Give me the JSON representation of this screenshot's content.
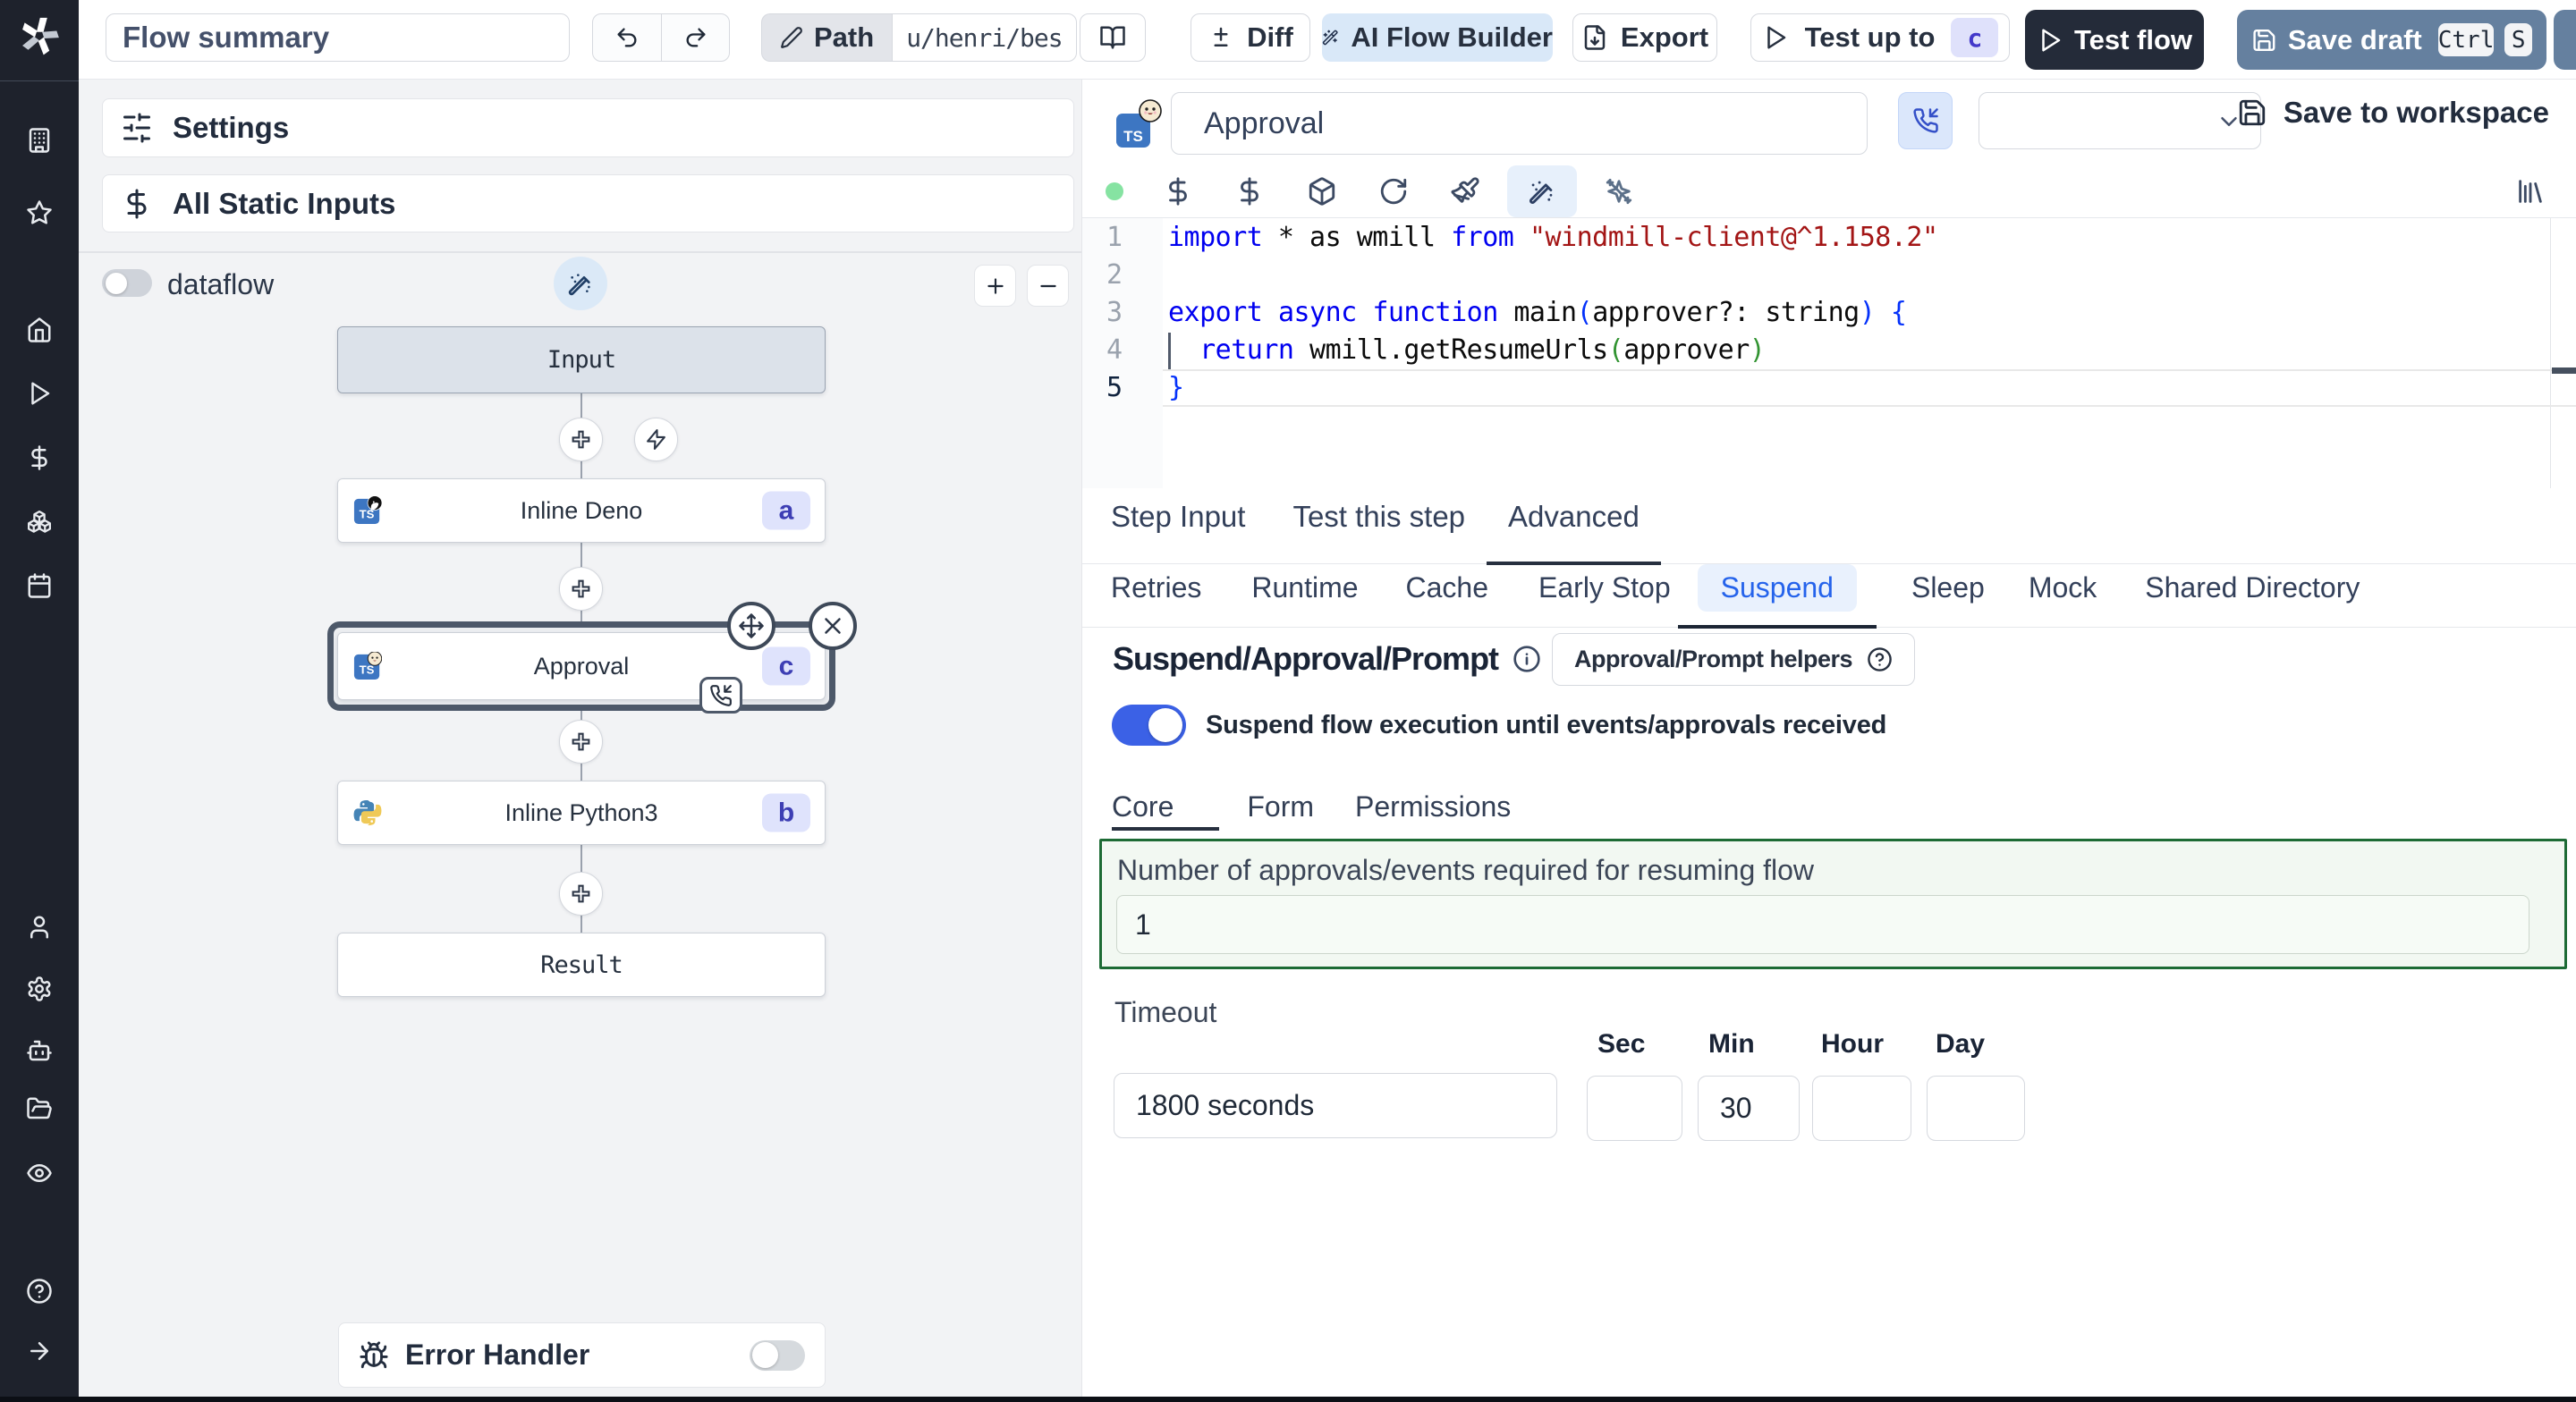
{
  "topbar": {
    "flow_summary": "Flow summary",
    "path_label": "Path",
    "path_value": "u/henri/bes",
    "diff_label": "Diff",
    "ai_flow_builder": "AI Flow Builder",
    "export_label": "Export",
    "test_up_to": "Test up to",
    "test_up_to_badge": "c",
    "test_flow": "Test flow",
    "save_draft": "Save draft",
    "kbd_ctrl": "Ctrl",
    "kbd_s": "S"
  },
  "left": {
    "settings": "Settings",
    "all_static_inputs": "All Static Inputs",
    "dataflow": "dataflow",
    "nodes": {
      "input": "Input",
      "deno_label": "Inline Deno",
      "deno_badge": "a",
      "approval_label": "Approval",
      "approval_badge": "c",
      "python_label": "Inline Python3",
      "python_badge": "b",
      "result": "Result"
    },
    "error_handler": "Error Handler"
  },
  "editor": {
    "step_name": "Approval",
    "ts_label": "TS",
    "save_to_workspace": "Save to workspace",
    "line_numbers": [
      "1",
      "2",
      "3",
      "4",
      "5"
    ],
    "lines": [
      [
        {
          "c": "kw",
          "t": "import"
        },
        {
          "c": "pl",
          "t": " * as wmill "
        },
        {
          "c": "kw",
          "t": "from"
        },
        {
          "c": "pl",
          "t": " "
        },
        {
          "c": "str",
          "t": "\"windmill-client@^1.158.2\""
        }
      ],
      [],
      [
        {
          "c": "kw",
          "t": "export"
        },
        {
          "c": "pl",
          "t": " "
        },
        {
          "c": "kw",
          "t": "async"
        },
        {
          "c": "pl",
          "t": " "
        },
        {
          "c": "kw",
          "t": "function"
        },
        {
          "c": "pl",
          "t": " main"
        },
        {
          "c": "br1",
          "t": "("
        },
        {
          "c": "pl",
          "t": "approver?: string"
        },
        {
          "c": "br1",
          "t": ")"
        },
        {
          "c": "pl",
          "t": " "
        },
        {
          "c": "br1",
          "t": "{"
        }
      ],
      [
        {
          "c": "pl",
          "t": "  "
        },
        {
          "c": "kw",
          "t": "return"
        },
        {
          "c": "pl",
          "t": " wmill.getResumeUrls"
        },
        {
          "c": "br2",
          "t": "("
        },
        {
          "c": "pl",
          "t": "approver"
        },
        {
          "c": "br2",
          "t": ")"
        }
      ],
      [
        {
          "c": "br1",
          "t": "}"
        }
      ]
    ]
  },
  "tabs": {
    "main": [
      {
        "label": "Step Input"
      },
      {
        "label": "Test this step"
      },
      {
        "label": "Advanced"
      }
    ],
    "advanced": [
      {
        "label": "Retries"
      },
      {
        "label": "Runtime"
      },
      {
        "label": "Cache"
      },
      {
        "label": "Early Stop"
      },
      {
        "label": "Suspend"
      },
      {
        "label": "Sleep"
      },
      {
        "label": "Mock"
      },
      {
        "label": "Shared Directory"
      }
    ]
  },
  "suspend": {
    "heading": "Suspend/Approval/Prompt",
    "helpers_button": "Approval/Prompt helpers",
    "toggle_label": "Suspend flow execution until events/approvals received",
    "tabs": [
      {
        "label": "Core"
      },
      {
        "label": "Form"
      },
      {
        "label": "Permissions"
      }
    ],
    "approvals_label": "Number of approvals/events required for resuming flow",
    "approvals_value": "1",
    "timeout_label": "Timeout",
    "timeout_value": "1800 seconds",
    "sec_label": "Sec",
    "min_label": "Min",
    "hour_label": "Hour",
    "day_label": "Day",
    "min_value": "30",
    "sec_value": "",
    "hour_value": "",
    "day_value": ""
  },
  "colors": {
    "accent_blue": "#3b61e6",
    "sidebar_bg": "#1e222c",
    "selected_ring": "#4d5869",
    "green_border": "#1d6b35",
    "suspend_active": "#2563eb",
    "save_draft_bg": "#65809f",
    "test_flow_bg": "#242b39"
  }
}
